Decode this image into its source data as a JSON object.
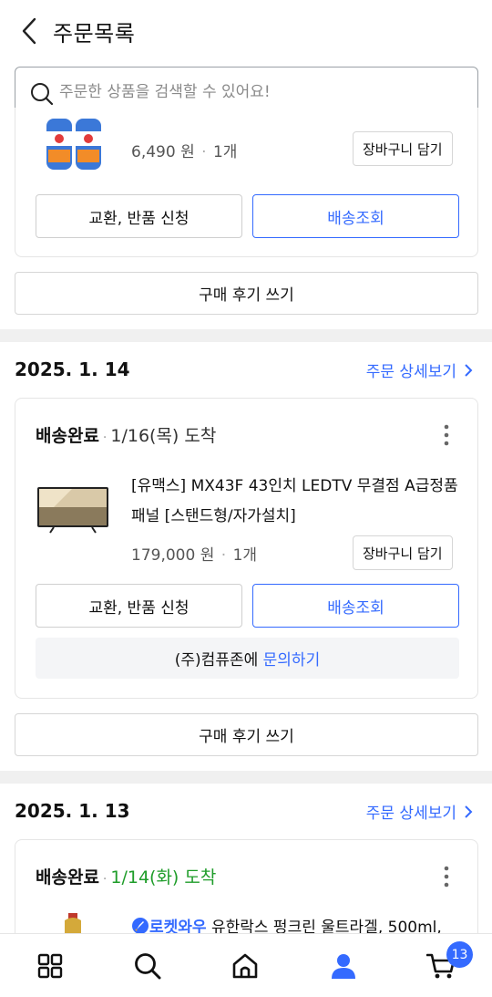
{
  "header": {
    "title": "주문목록"
  },
  "search": {
    "placeholder": "주문한 상품을 검색할 수 있어요!"
  },
  "orders": [
    {
      "price": "6,490 원",
      "qty": "1개",
      "cart_label": "장바구니 담기",
      "exchange_label": "교환, 반품 신청",
      "tracking_label": "배송조회",
      "review_label": "구매 후기 쓰기"
    },
    {
      "date": "2025. 1. 14",
      "detail_label": "주문 상세보기",
      "status": "배송완료",
      "arrival": "1/16(목) 도착",
      "product_title": "[유맥스] MX43F 43인치 LEDTV 무결점 A급정품패널 [스탠드형/자가설치]",
      "price": "179,000 원",
      "qty": "1개",
      "cart_label": "장바구니 담기",
      "exchange_label": "교환, 반품 신청",
      "tracking_label": "배송조회",
      "seller": "(주)컴퓨존에",
      "inquiry_label": "문의하기",
      "review_label": "구매 후기 쓰기"
    },
    {
      "date": "2025. 1. 13",
      "detail_label": "주문 상세보기",
      "status": "배송완료",
      "arrival": "1/14(화) 도착",
      "brand": "로켓와우",
      "product_title": "유한락스 펑크린 울트라겔, 500ml,"
    }
  ],
  "bottom_nav": {
    "items": [
      "category-icon",
      "search-icon",
      "home-icon",
      "my-coupang-icon",
      "cart-icon"
    ],
    "cart_count": "13"
  },
  "colors": {
    "accent": "#346aff",
    "arrival_green": "#1f9d2a"
  }
}
